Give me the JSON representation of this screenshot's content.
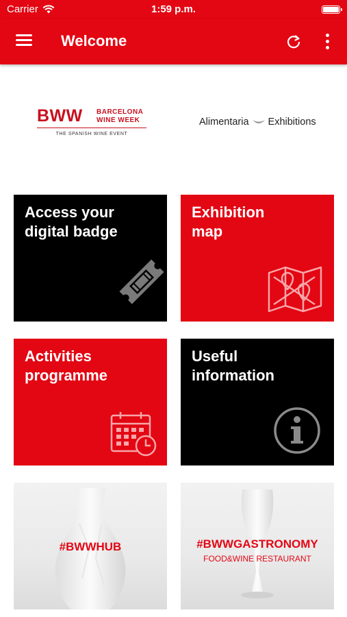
{
  "status_bar": {
    "carrier": "Carrier",
    "time": "1:59 p.m."
  },
  "app_bar": {
    "title": "Welcome"
  },
  "logos": {
    "bww": {
      "mark": "BWW",
      "city_line1": "BARCELONA",
      "city_line2": "WINE WEEK",
      "tagline": "THE SPANISH WINE EVENT"
    },
    "alimentaria": {
      "left": "Alimentaria",
      "right": "Exhibitions"
    }
  },
  "tiles": [
    {
      "title": "Access your\ndigital badge",
      "icon": "ticket-icon",
      "color": "#000000"
    },
    {
      "title": "Exhibition\nmap",
      "icon": "map-icon",
      "color": "#e30613"
    },
    {
      "title": "Activities\nprogramme",
      "icon": "calendar-clock-icon",
      "color": "#e30613"
    },
    {
      "title": "Useful\ninformation",
      "icon": "info-icon",
      "color": "#000000"
    }
  ],
  "photo_tiles": [
    {
      "hashtag": "#BWWHUB"
    },
    {
      "hashtag": "#BWWGASTRONOMY",
      "subtitle": "FOOD&WINE RESTAURANT"
    }
  ],
  "colors": {
    "brand_red": "#e30613",
    "tile_black": "#000000"
  }
}
